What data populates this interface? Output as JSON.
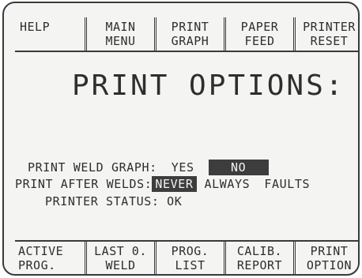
{
  "top_softkeys": [
    {
      "line1": "HELP",
      "line2": ""
    },
    {
      "line1": "MAIN",
      "line2": "MENU"
    },
    {
      "line1": "PRINT",
      "line2": "GRAPH"
    },
    {
      "line1": "PAPER",
      "line2": "FEED"
    },
    {
      "line1": "PRINTER",
      "line2": "RESET"
    }
  ],
  "title": "PRINT OPTIONS:",
  "print_weld_graph": {
    "label": "PRINT WELD GRAPH:",
    "options": [
      "YES",
      "NO"
    ],
    "selected": "NO"
  },
  "print_after_welds": {
    "label": "PRINT AFTER WELDS:",
    "options": [
      "NEVER",
      "ALWAYS",
      "FAULTS"
    ],
    "selected": "NEVER"
  },
  "printer_status": {
    "label": "PRINTER STATUS:",
    "value": "OK"
  },
  "bottom_softkeys": [
    {
      "line1": "ACTIVE",
      "line2": "PROG."
    },
    {
      "line1": "LAST 0.",
      "line2": "WELD"
    },
    {
      "line1": "PROG.",
      "line2": "LIST"
    },
    {
      "line1": "CALIB.",
      "line2": "REPORT"
    },
    {
      "line1": "PRINT",
      "line2": "OPTION"
    }
  ],
  "colors": {
    "screen_background": "#f4f4f2",
    "text": "#2e2e2e",
    "highlight": "#3d3d3d"
  }
}
